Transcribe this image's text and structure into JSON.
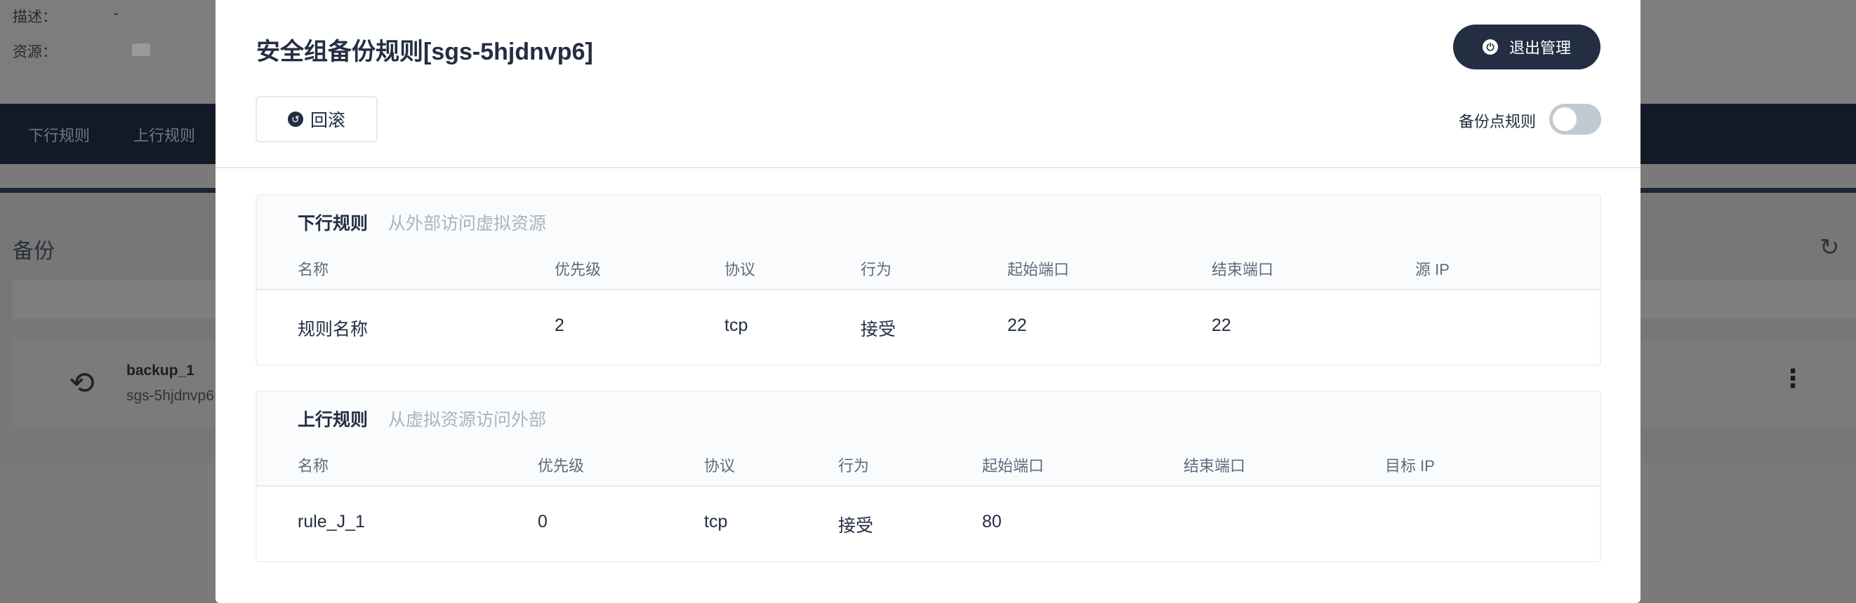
{
  "background": {
    "description_label": "描述：",
    "description_value": "-",
    "resource_label": "资源：",
    "nav": [
      "下行规则",
      "上行规则"
    ],
    "section_title": "备份",
    "backup_item": {
      "name": "backup_1",
      "group": "sgs-5hjdnvp6"
    }
  },
  "modal": {
    "title": "安全组备份规则[sgs-5hjdnvp6]",
    "exit_label": "退出管理",
    "rollback_label": "回滚",
    "toggle_label": "备份点规则",
    "toggle_on": false,
    "ingress": {
      "title": "下行规则",
      "desc": "从外部访问虚拟资源",
      "columns": [
        "名称",
        "优先级",
        "协议",
        "行为",
        "起始端口",
        "结束端口",
        "源 IP"
      ],
      "rows": [
        [
          "规则名称",
          "2",
          "tcp",
          "接受",
          "22",
          "22",
          ""
        ]
      ]
    },
    "egress": {
      "title": "上行规则",
      "desc": "从虚拟资源访问外部",
      "columns": [
        "名称",
        "优先级",
        "协议",
        "行为",
        "起始端口",
        "结束端口",
        "目标 IP"
      ],
      "rows": [
        [
          "rule_J_1",
          "0",
          "tcp",
          "接受",
          "80",
          "",
          ""
        ]
      ]
    }
  },
  "colors": {
    "primary_dark": "#242e42",
    "muted_text": "#abb4be",
    "toggle_off": "#c1c9d1"
  }
}
